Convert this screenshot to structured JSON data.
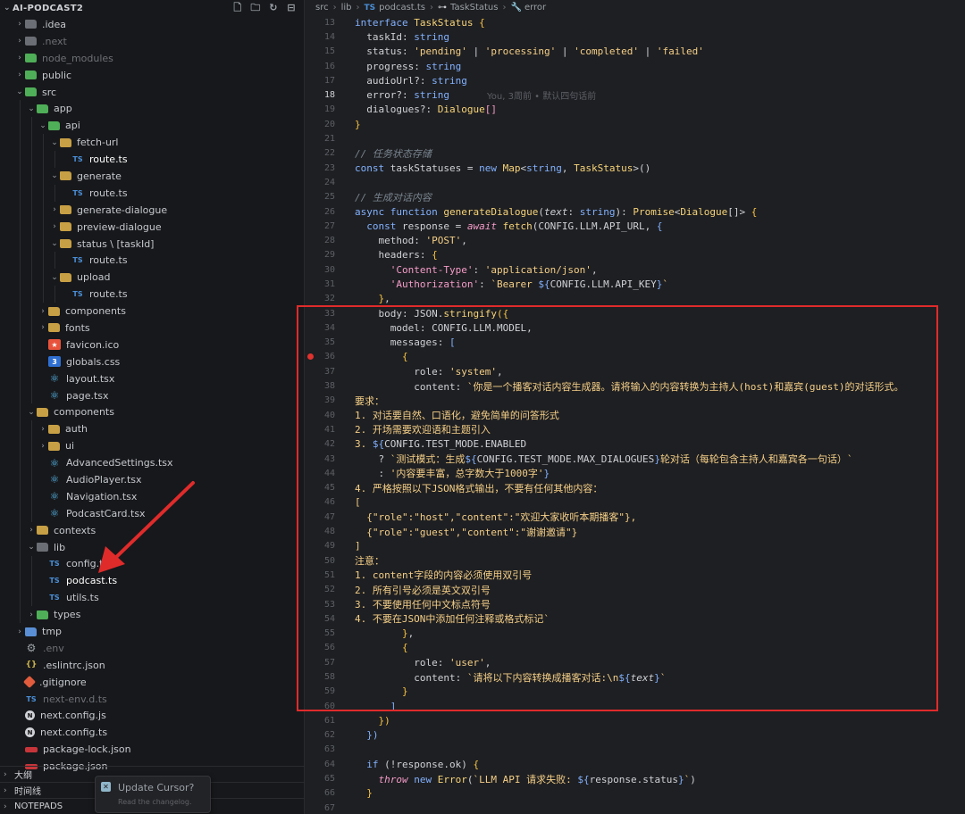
{
  "sidebar": {
    "project_title": "AI-PODCAST2",
    "tree": [
      {
        "label": ".idea",
        "depth": 0,
        "kind": "folder-gray",
        "chev": "›",
        "dim": false
      },
      {
        "label": ".next",
        "depth": 0,
        "kind": "folder-gray",
        "chev": "›",
        "dim": true
      },
      {
        "label": "node_modules",
        "depth": 0,
        "kind": "folder-green",
        "chev": "›",
        "dim": true
      },
      {
        "label": "public",
        "depth": 0,
        "kind": "folder-green",
        "chev": "›",
        "dim": false
      },
      {
        "label": "src",
        "depth": 0,
        "kind": "folder-green",
        "chev": "⌄",
        "dim": false
      },
      {
        "label": "app",
        "depth": 1,
        "kind": "folder-green",
        "chev": "⌄",
        "dim": false
      },
      {
        "label": "api",
        "depth": 2,
        "kind": "folder-green",
        "chev": "⌄",
        "dim": false
      },
      {
        "label": "fetch-url",
        "depth": 3,
        "kind": "folder",
        "chev": "⌄",
        "dim": false
      },
      {
        "label": "route.ts",
        "depth": 4,
        "kind": "ts",
        "chev": "",
        "dim": false,
        "bright": true
      },
      {
        "label": "generate",
        "depth": 3,
        "kind": "folder",
        "chev": "⌄",
        "dim": false
      },
      {
        "label": "route.ts",
        "depth": 4,
        "kind": "ts",
        "chev": "",
        "dim": false
      },
      {
        "label": "generate-dialogue",
        "depth": 3,
        "kind": "folder",
        "chev": "›",
        "dim": false
      },
      {
        "label": "preview-dialogue",
        "depth": 3,
        "kind": "folder",
        "chev": "›",
        "dim": false
      },
      {
        "label": "status \\ [taskId]",
        "depth": 3,
        "kind": "folder",
        "chev": "⌄",
        "dim": false
      },
      {
        "label": "route.ts",
        "depth": 4,
        "kind": "ts",
        "chev": "",
        "dim": false
      },
      {
        "label": "upload",
        "depth": 3,
        "kind": "folder",
        "chev": "⌄",
        "dim": false
      },
      {
        "label": "route.ts",
        "depth": 4,
        "kind": "ts",
        "chev": "",
        "dim": false
      },
      {
        "label": "components",
        "depth": 2,
        "kind": "folder",
        "chev": "›",
        "dim": false
      },
      {
        "label": "fonts",
        "depth": 2,
        "kind": "folder",
        "chev": "›",
        "dim": false
      },
      {
        "label": "favicon.ico",
        "depth": 2,
        "kind": "star",
        "chev": "",
        "dim": false
      },
      {
        "label": "globals.css",
        "depth": 2,
        "kind": "css",
        "chev": "",
        "dim": false
      },
      {
        "label": "layout.tsx",
        "depth": 2,
        "kind": "react",
        "chev": "",
        "dim": false
      },
      {
        "label": "page.tsx",
        "depth": 2,
        "kind": "react",
        "chev": "",
        "dim": false
      },
      {
        "label": "components",
        "depth": 1,
        "kind": "folder",
        "chev": "⌄",
        "dim": false
      },
      {
        "label": "auth",
        "depth": 2,
        "kind": "folder",
        "chev": "›",
        "dim": false
      },
      {
        "label": "ui",
        "depth": 2,
        "kind": "folder",
        "chev": "›",
        "dim": false
      },
      {
        "label": "AdvancedSettings.tsx",
        "depth": 2,
        "kind": "react",
        "chev": "",
        "dim": false
      },
      {
        "label": "AudioPlayer.tsx",
        "depth": 2,
        "kind": "react",
        "chev": "",
        "dim": false
      },
      {
        "label": "Navigation.tsx",
        "depth": 2,
        "kind": "react",
        "chev": "",
        "dim": false
      },
      {
        "label": "PodcastCard.tsx",
        "depth": 2,
        "kind": "react",
        "chev": "",
        "dim": false
      },
      {
        "label": "contexts",
        "depth": 1,
        "kind": "folder",
        "chev": "›",
        "dim": false
      },
      {
        "label": "lib",
        "depth": 1,
        "kind": "folder-gray",
        "chev": "⌄",
        "dim": false
      },
      {
        "label": "config.ts",
        "depth": 2,
        "kind": "ts",
        "chev": "",
        "dim": false
      },
      {
        "label": "podcast.ts",
        "depth": 2,
        "kind": "ts",
        "chev": "",
        "dim": false,
        "bright": true
      },
      {
        "label": "utils.ts",
        "depth": 2,
        "kind": "ts",
        "chev": "",
        "dim": false
      },
      {
        "label": "types",
        "depth": 1,
        "kind": "folder-green",
        "chev": "›",
        "dim": false
      },
      {
        "label": "tmp",
        "depth": 0,
        "kind": "folder-blue",
        "chev": "›",
        "dim": false
      },
      {
        "label": ".env",
        "depth": 0,
        "kind": "gear",
        "chev": "",
        "dim": true
      },
      {
        "label": ".eslintrc.json",
        "depth": 0,
        "kind": "json",
        "chev": "",
        "dim": false
      },
      {
        "label": ".gitignore",
        "depth": 0,
        "kind": "git",
        "chev": "",
        "dim": false
      },
      {
        "label": "next-env.d.ts",
        "depth": 0,
        "kind": "ts",
        "chev": "",
        "dim": true
      },
      {
        "label": "next.config.js",
        "depth": 0,
        "kind": "next",
        "chev": "",
        "dim": false
      },
      {
        "label": "next.config.ts",
        "depth": 0,
        "kind": "next",
        "chev": "",
        "dim": false
      },
      {
        "label": "package-lock.json",
        "depth": 0,
        "kind": "npm",
        "chev": "",
        "dim": false
      },
      {
        "label": "package.json",
        "depth": 0,
        "kind": "npm",
        "chev": "",
        "dim": false
      }
    ],
    "panels": [
      "大纲",
      "时间线",
      "NOTEPADS"
    ]
  },
  "toast": {
    "title": "Update Cursor?",
    "subtitle": "Read the changelog."
  },
  "breadcrumb": {
    "parts": [
      "src",
      "lib"
    ],
    "file_badge": "TS",
    "file": "podcast.ts",
    "symbol": "TaskStatus",
    "member": "error"
  },
  "editor": {
    "current_line": 18,
    "breakpoint_line": 36,
    "blame": "You, 3周前 • 默认四句话前",
    "lines": [
      {
        "n": 13,
        "html": "<span class='kb'>interface</span> <span class='ty'>TaskStatus</span> <span class='pu'>{</span>"
      },
      {
        "n": 14,
        "html": "  <span class='pr'>taskId</span>: <span class='kb'>string</span>"
      },
      {
        "n": 15,
        "html": "  <span class='pr'>status</span>: <span class='st'>'pending'</span> | <span class='st'>'processing'</span> | <span class='st'>'completed'</span> | <span class='st'>'failed'</span>"
      },
      {
        "n": 16,
        "html": "  <span class='pr'>progress</span>: <span class='kb'>string</span>"
      },
      {
        "n": 17,
        "html": "  <span class='pr'>audioUrl</span>?: <span class='kb'>string</span>"
      },
      {
        "n": 18,
        "html": "  <span class='pr'>error</span>?: <span class='kb'>string</span>"
      },
      {
        "n": 19,
        "html": "  <span class='pr'>dialogues</span>?: <span class='ty'>Dialogue</span><span class='k'>[]</span>"
      },
      {
        "n": 20,
        "html": "<span class='pu'>}</span>"
      },
      {
        "n": 21,
        "html": ""
      },
      {
        "n": 22,
        "html": "<span class='cm'>// 任务状态存储</span>"
      },
      {
        "n": 23,
        "html": "<span class='kb'>const</span> <span class='id'>taskStatuses</span> = <span class='kb'>new</span> <span class='fn'>Map</span>&lt;<span class='kb'>string</span>, <span class='ty'>TaskStatus</span>&gt;()"
      },
      {
        "n": 24,
        "html": ""
      },
      {
        "n": 25,
        "html": "<span class='cm'>// 生成对话内容</span>"
      },
      {
        "n": 26,
        "html": "<span class='kb'>async</span> <span class='kb'>function</span> <span class='fn'>generateDialogue</span>(<span class='it'>text</span>: <span class='kb'>string</span>): <span class='ty'>Promise</span>&lt;<span class='ty'>Dialogue</span>[]&gt; <span class='pu'>{</span>"
      },
      {
        "n": 27,
        "html": "  <span class='kb'>const</span> <span class='id'>response</span> = <span class='k it'>await</span> <span class='fn'>fetch</span>(<span class='cn'>CONFIG.LLM.API_URL</span>, <span class='kb'>{</span>"
      },
      {
        "n": 28,
        "html": "    <span class='pr'>method</span>: <span class='st'>'POST'</span>,"
      },
      {
        "n": 29,
        "html": "    <span class='pr'>headers</span>: <span class='pu'>{</span>"
      },
      {
        "n": 30,
        "html": "      <span class='k'>'Content-Type'</span>: <span class='st'>'application/json'</span>,"
      },
      {
        "n": 31,
        "html": "      <span class='k'>'Authorization'</span>: <span class='st'>`Bearer </span><span class='kb'>${</span><span class='cn'>CONFIG.LLM.API_KEY</span><span class='kb'>}</span><span class='st'>`</span>"
      },
      {
        "n": 32,
        "html": "    <span class='pu'>}</span>,"
      },
      {
        "n": 33,
        "html": "    <span class='pr'>body</span>: <span class='cn'>JSON</span>.<span class='fn'>stringify</span><span class='pu'>({</span>"
      },
      {
        "n": 34,
        "html": "      <span class='pr'>model</span>: <span class='cn'>CONFIG.LLM.MODEL</span>,"
      },
      {
        "n": 35,
        "html": "      <span class='pr'>messages</span>: <span class='kb'>[</span>"
      },
      {
        "n": 36,
        "html": "        <span class='pu'>{</span>"
      },
      {
        "n": 37,
        "html": "          <span class='pr'>role</span>: <span class='st'>'system'</span>,"
      },
      {
        "n": 38,
        "html": "          <span class='pr'>content</span>: <span class='st'>`你是一个播客对话内容生成器。请将输入的内容转换为主持人(host)和嘉宾(guest)的对话形式。</span>"
      },
      {
        "n": 39,
        "html": "<span class='st'>要求：</span>"
      },
      {
        "n": 40,
        "html": "<span class='st'>1. 对话要自然、口语化，避免简单的问答形式</span>"
      },
      {
        "n": 41,
        "html": "<span class='st'>2. 开场需要欢迎语和主题引入</span>"
      },
      {
        "n": 42,
        "html": "<span class='st'>3. </span><span class='kb'>${</span><span class='cn'>CONFIG.TEST_MODE.ENABLED</span>"
      },
      {
        "n": 43,
        "html": "    ? <span class='st'>`测试模式：生成</span><span class='kb'>${</span><span class='cn'>CONFIG.TEST_MODE.MAX_DIALOGUES</span><span class='kb'>}</span><span class='st'>轮对话（每轮包含主持人和嘉宾各一句话）`</span>"
      },
      {
        "n": 44,
        "html": "    : <span class='st'>'内容要丰富，总字数大于1000字'</span><span class='kb'>}</span>"
      },
      {
        "n": 45,
        "html": "<span class='st'>4. 严格按照以下JSON格式输出，不要有任何其他内容：</span>"
      },
      {
        "n": 46,
        "html": "<span class='st'>[</span>"
      },
      {
        "n": 47,
        "html": "<span class='st'>  {\"role\":\"host\",\"content\":\"欢迎大家收听本期播客\"},</span>"
      },
      {
        "n": 48,
        "html": "<span class='st'>  {\"role\":\"guest\",\"content\":\"谢谢邀请\"}</span>"
      },
      {
        "n": 49,
        "html": "<span class='st'>]</span>"
      },
      {
        "n": 50,
        "html": "<span class='st'>注意：</span>"
      },
      {
        "n": 51,
        "html": "<span class='st'>1. content字段的内容必须使用双引号</span>"
      },
      {
        "n": 52,
        "html": "<span class='st'>2. 所有引号必须是英文双引号</span>"
      },
      {
        "n": 53,
        "html": "<span class='st'>3. 不要使用任何中文标点符号</span>"
      },
      {
        "n": 54,
        "html": "<span class='st'>4. 不要在JSON中添加任何注释或格式标记`</span>"
      },
      {
        "n": 55,
        "html": "        <span class='pu'>}</span>,"
      },
      {
        "n": 56,
        "html": "        <span class='pu'>{</span>"
      },
      {
        "n": 57,
        "html": "          <span class='pr'>role</span>: <span class='st'>'user'</span>,"
      },
      {
        "n": 58,
        "html": "          <span class='pr'>content</span>: <span class='st'>`请将以下内容转换成播客对话:\\n</span><span class='kb'>${</span><span class='it'>text</span><span class='kb'>}</span><span class='st'>`</span>"
      },
      {
        "n": 59,
        "html": "        <span class='pu'>}</span>"
      },
      {
        "n": 60,
        "html": "      <span class='kb'>]</span>"
      },
      {
        "n": 61,
        "html": "    <span class='pu'>})</span>"
      },
      {
        "n": 62,
        "html": "  <span class='kb'>})</span>"
      },
      {
        "n": 63,
        "html": ""
      },
      {
        "n": 64,
        "html": "  <span class='kb'>if</span> (!<span class='id'>response</span>.<span class='pr'>ok</span>) <span class='pu'>{</span>"
      },
      {
        "n": 65,
        "html": "    <span class='k it'>throw</span> <span class='kb'>new</span> <span class='fn'>Error</span>(<span class='st'>`LLM API 请求失败: </span><span class='kb'>${</span><span class='id'>response</span>.<span class='pr'>status</span><span class='kb'>}</span><span class='st'>`</span>)"
      },
      {
        "n": 66,
        "html": "  <span class='pu'>}</span>"
      },
      {
        "n": 67,
        "html": ""
      }
    ]
  },
  "colors": {
    "annotation_red": "#e02b2b",
    "breakpoint": "#e0322e"
  }
}
